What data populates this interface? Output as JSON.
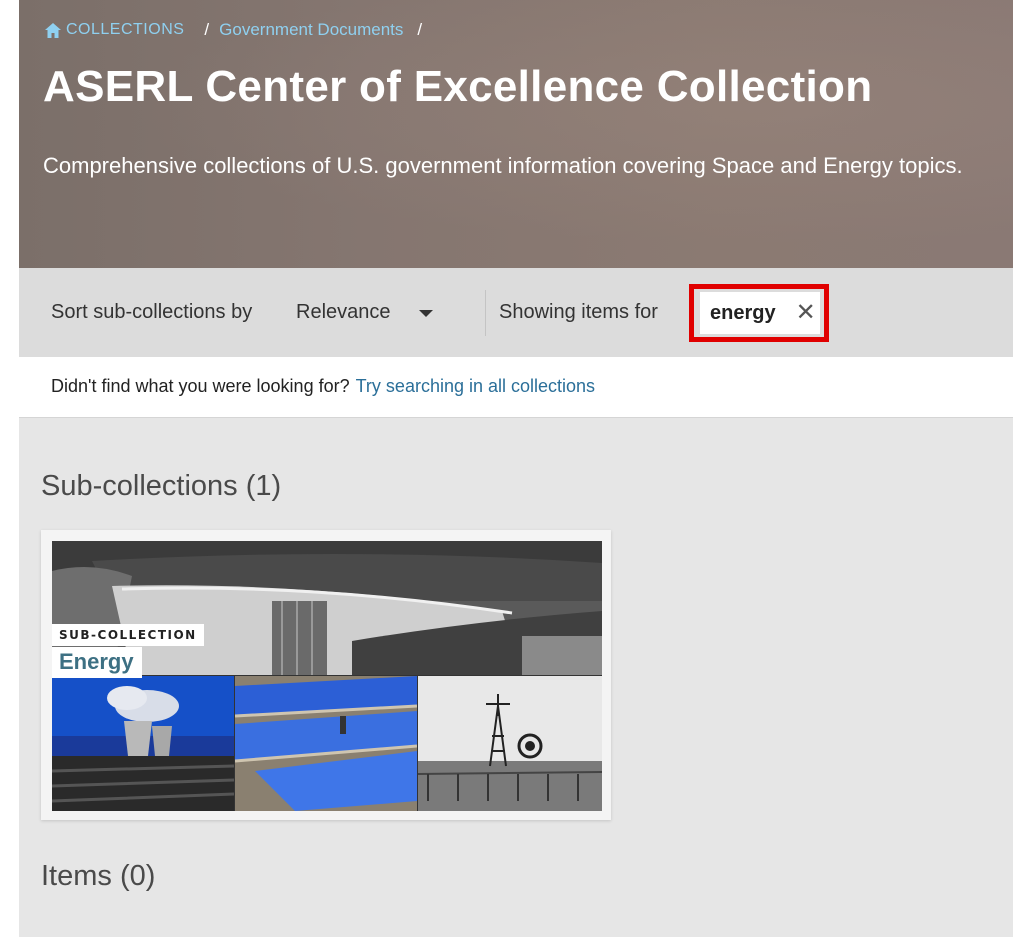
{
  "breadcrumb": {
    "home_label": "COLLECTIONS",
    "separator": "/",
    "parent_label": "Government Documents"
  },
  "header": {
    "title": "ASERL Center of Excellence Collection",
    "description": "Comprehensive collections of U.S. government information covering Space and Energy topics."
  },
  "toolbar": {
    "sort_label": "Sort sub-collections by",
    "sort_value": "Relevance",
    "showing_label": "Showing items for",
    "filter_chip": "energy",
    "filter_remove": "✕"
  },
  "hint": {
    "text": "Didn't find what you were looking for?",
    "link": "Try searching in all collections"
  },
  "subcollections": {
    "heading": "Sub-collections (1)",
    "cards": [
      {
        "tag": "SUB-COLLECTION",
        "title": "Energy"
      }
    ]
  },
  "items": {
    "heading": "Items (0)"
  },
  "colors": {
    "link": "#2b6f99",
    "breadcrumb": "#8fd0f0",
    "highlight": "#e00000",
    "card_title": "#3d7083"
  },
  "icons": {
    "home": "home-icon",
    "caret": "chevron-down-icon",
    "close": "close-icon"
  }
}
